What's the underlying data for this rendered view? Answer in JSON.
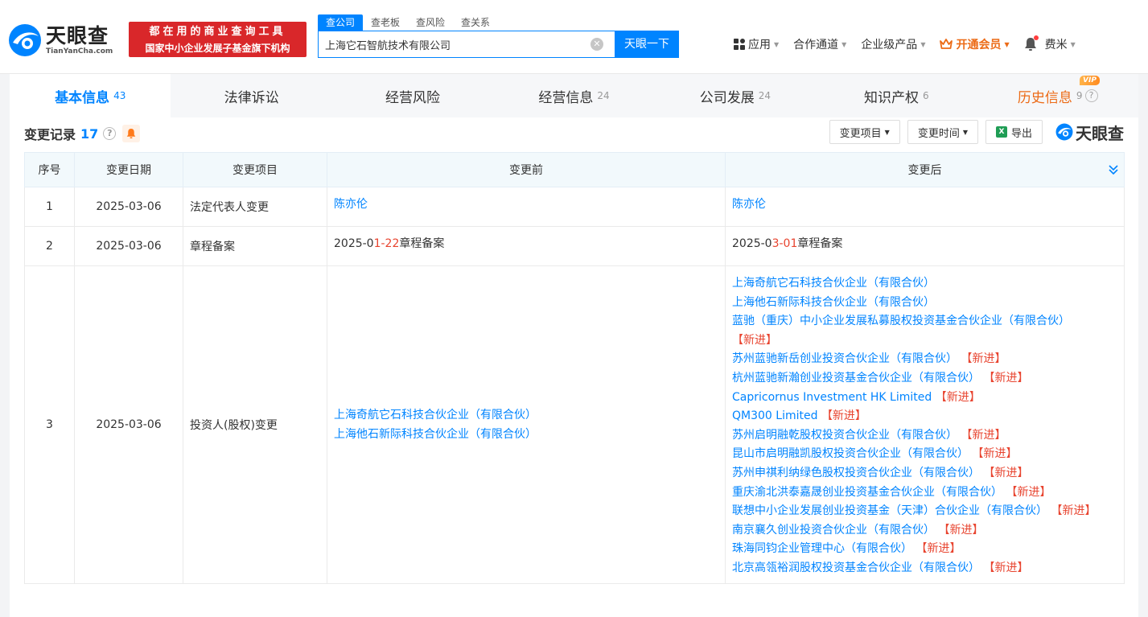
{
  "header": {
    "logo_cn": "天眼查",
    "logo_en": "TianYanCha.com",
    "banner_line1": "都在用的商业查询工具",
    "banner_line2": "国家中小企业发展子基金旗下机构",
    "search_tabs": [
      "查公司",
      "查老板",
      "查风险",
      "查关系"
    ],
    "search_value": "上海它石智航技术有限公司",
    "search_button": "天眼一下",
    "nav": {
      "apps": "应用",
      "partner": "合作通道",
      "enterprise": "企业级产品",
      "vip": "开通会员",
      "user": "费米"
    }
  },
  "tabs": [
    {
      "label": "基本信息",
      "count": "43"
    },
    {
      "label": "法律诉讼",
      "count": ""
    },
    {
      "label": "经营风险",
      "count": ""
    },
    {
      "label": "经营信息",
      "count": "24"
    },
    {
      "label": "公司发展",
      "count": "24"
    },
    {
      "label": "知识产权",
      "count": "6"
    },
    {
      "label": "历史信息",
      "count": "9",
      "badge": "VIP"
    }
  ],
  "section": {
    "title": "变更记录",
    "count": "17",
    "filter_item": "变更项目",
    "filter_time": "变更时间",
    "export": "导出",
    "brand": "天眼查"
  },
  "table": {
    "headers": [
      "序号",
      "变更日期",
      "变更项目",
      "变更前",
      "变更后"
    ],
    "rows": [
      {
        "idx": "1",
        "date": "2025-03-06",
        "item": "法定代表人变更",
        "before": "陈亦伦",
        "after": "陈亦伦"
      },
      {
        "idx": "2",
        "date": "2025-03-06",
        "item": "章程备案",
        "before_parts": [
          "2025-0",
          "1-22",
          "章程备案"
        ],
        "after_parts": [
          "2025-0",
          "3-01",
          "章程备案"
        ]
      },
      {
        "idx": "3",
        "date": "2025-03-06",
        "item": "投资人(股权)变更",
        "before_list": [
          "上海奇航它石科技合伙企业（有限合伙）",
          "上海他石新际科技合伙企业（有限合伙）"
        ],
        "new_tag": "【新进】",
        "after_list": [
          {
            "name": "上海奇航它石科技合伙企业（有限合伙）",
            "new": false
          },
          {
            "name": "上海他石新际科技合伙企业（有限合伙）",
            "new": false
          },
          {
            "name": "蓝驰（重庆）中小企业发展私募股权投资基金合伙企业（有限合伙）",
            "new": true,
            "br": true
          },
          {
            "name": "苏州蓝驰新岳创业投资合伙企业（有限合伙）",
            "new": true
          },
          {
            "name": "杭州蓝驰新瀚创业投资基金合伙企业（有限合伙）",
            "new": true
          },
          {
            "name": "Capricornus Investment HK Limited",
            "new": true
          },
          {
            "name": "QM300 Limited",
            "new": true
          },
          {
            "name": "苏州启明融乾股权投资合伙企业（有限合伙）",
            "new": true
          },
          {
            "name": "昆山市启明融凯股权投资合伙企业（有限合伙）",
            "new": true
          },
          {
            "name": "苏州申祺利纳绿色股权投资合伙企业（有限合伙）",
            "new": true
          },
          {
            "name": "重庆渝北洪泰嘉晟创业投资基金合伙企业（有限合伙）",
            "new": true
          },
          {
            "name": "联想中小企业发展创业投资基金（天津）合伙企业（有限合伙）",
            "new": true,
            "split": true
          },
          {
            "name": "南京襄久创业投资合伙企业（有限合伙）",
            "new": true
          },
          {
            "name": "珠海同钧企业管理中心（有限合伙）",
            "new": true
          },
          {
            "name": "北京高瓴裕润股权投资基金合伙企业（有限合伙）",
            "new": true
          }
        ]
      }
    ]
  },
  "colors": {
    "brand_blue": "#0084ff",
    "banner_red": "#d9272a",
    "vip_orange": "#ec6b17",
    "new_red": "#e8442f"
  }
}
